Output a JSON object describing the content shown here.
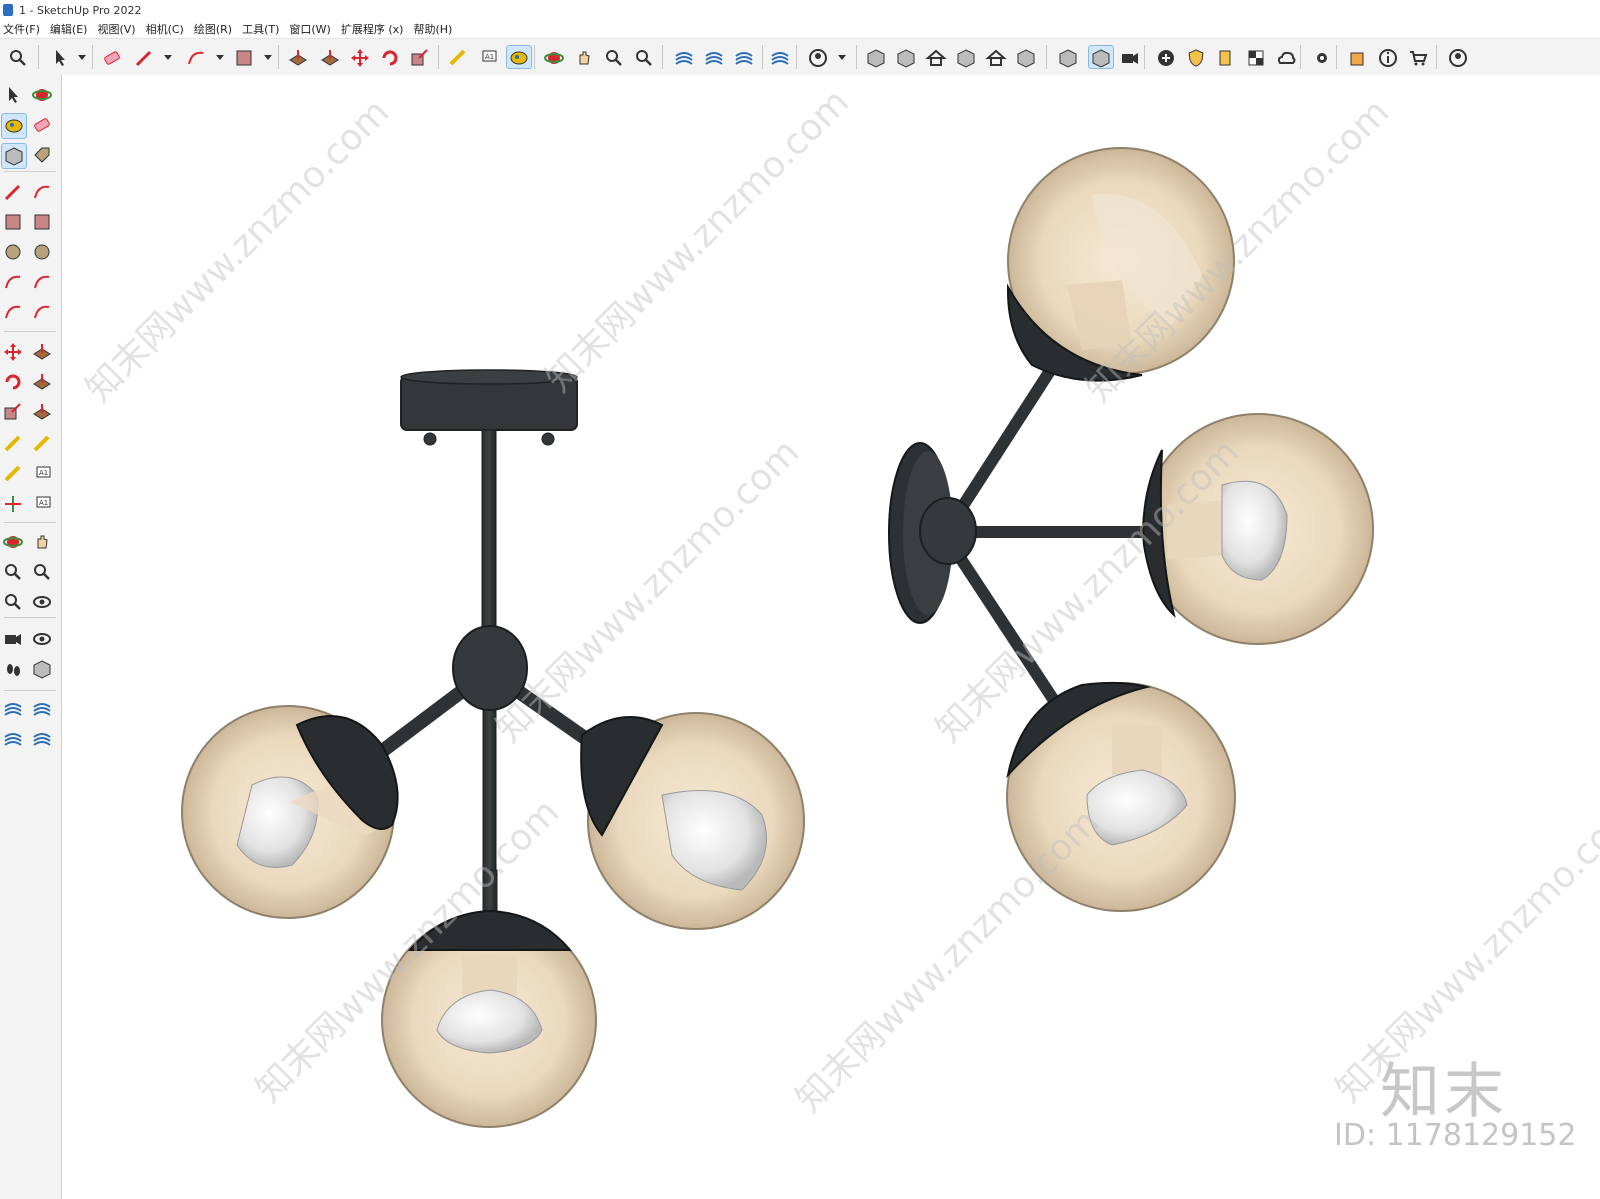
{
  "window": {
    "title": "1 - SketchUp Pro 2022"
  },
  "menu": [
    "文件(F)",
    "编辑(E)",
    "视图(V)",
    "相机(C)",
    "绘图(R)",
    "工具(T)",
    "窗口(W)",
    "扩展程序 (x)",
    "帮助(H)"
  ],
  "watermark": {
    "logo": "知末",
    "id": "ID: 1178129152",
    "diagonal": "知末网www.znzmo.com"
  },
  "icons": {
    "top": [
      "search-icon",
      "select-icon",
      "dropdown-icon",
      "eraser-icon",
      "pencil-icon",
      "dropdown-icon",
      "arc-icon",
      "dropdown-icon",
      "rectangle-icon",
      "dropdown-icon",
      "pushpull-icon",
      "followme-icon",
      "move-icon",
      "rotate-icon",
      "scale-icon",
      "tape-icon",
      "text-icon",
      "paint-icon",
      "orbit-icon",
      "pan-icon",
      "zoom-icon",
      "zoom-extents-icon",
      "warehouse-icon",
      "extension-icon",
      "layers-icon",
      "sandbox-icon",
      "account-icon",
      "dropdown-icon",
      "iso-view-icon",
      "front-view-icon",
      "home-icon",
      "section-icon",
      "house-icon",
      "box-icon",
      "solid-icon",
      "component-icon",
      "camera-icon",
      "add-icon",
      "shield-icon",
      "stack-icon",
      "checker-icon",
      "cloud-icon",
      "gear-icon",
      "window-icon",
      "info-icon",
      "cart-icon",
      "profile-icon"
    ],
    "left": [
      "select-icon",
      "orbit-icon",
      "paint-icon",
      "eraser-icon",
      "component-icon",
      "tag-icon",
      "pencil-icon",
      "freehand-icon",
      "rectangle-icon",
      "rotated-rect-icon",
      "circle-icon",
      "polygon-icon",
      "arc-icon",
      "arc2-icon",
      "pie-icon",
      "arc3-icon",
      "move-icon",
      "pushpull-icon",
      "rotate-icon",
      "followme-icon",
      "scale-icon",
      "offset-icon",
      "tape-icon",
      "dimension-icon",
      "protractor-icon",
      "text-icon",
      "axes-icon",
      "3dtext-icon",
      "orbit2-icon",
      "pan-icon",
      "zoom-icon",
      "zoom-window-icon",
      "zoom-extents-icon",
      "previous-icon",
      "position-camera-icon",
      "lookaround-icon",
      "walk-icon",
      "section-plane-icon",
      "warehouse-icon",
      "extension-icon",
      "layers-icon",
      "sandbox-icon"
    ]
  }
}
